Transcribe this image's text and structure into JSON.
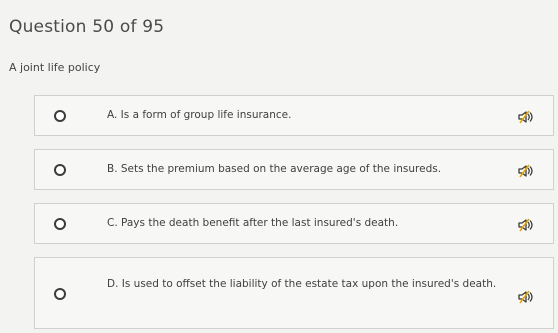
{
  "header": {
    "question_counter": "Question 50 of 95"
  },
  "question": {
    "prompt": "A joint life policy"
  },
  "options": [
    {
      "label": "A. Is a form of group life insurance.",
      "icon": "speaker-muted-icon"
    },
    {
      "label": "B. Sets the premium based on the average age of the insureds.",
      "icon": "speaker-muted-icon"
    },
    {
      "label": "C. Pays the death benefit after the last insured's death.",
      "icon": "speaker-muted-icon"
    },
    {
      "label": "D. Is used to offset the liability of the estate tax upon the insured's death.",
      "icon": "speaker-muted-icon"
    }
  ],
  "colors": {
    "background": "#f3f4f2",
    "card_border": "#cfd1cf",
    "icon_accent": "#e3a400"
  }
}
